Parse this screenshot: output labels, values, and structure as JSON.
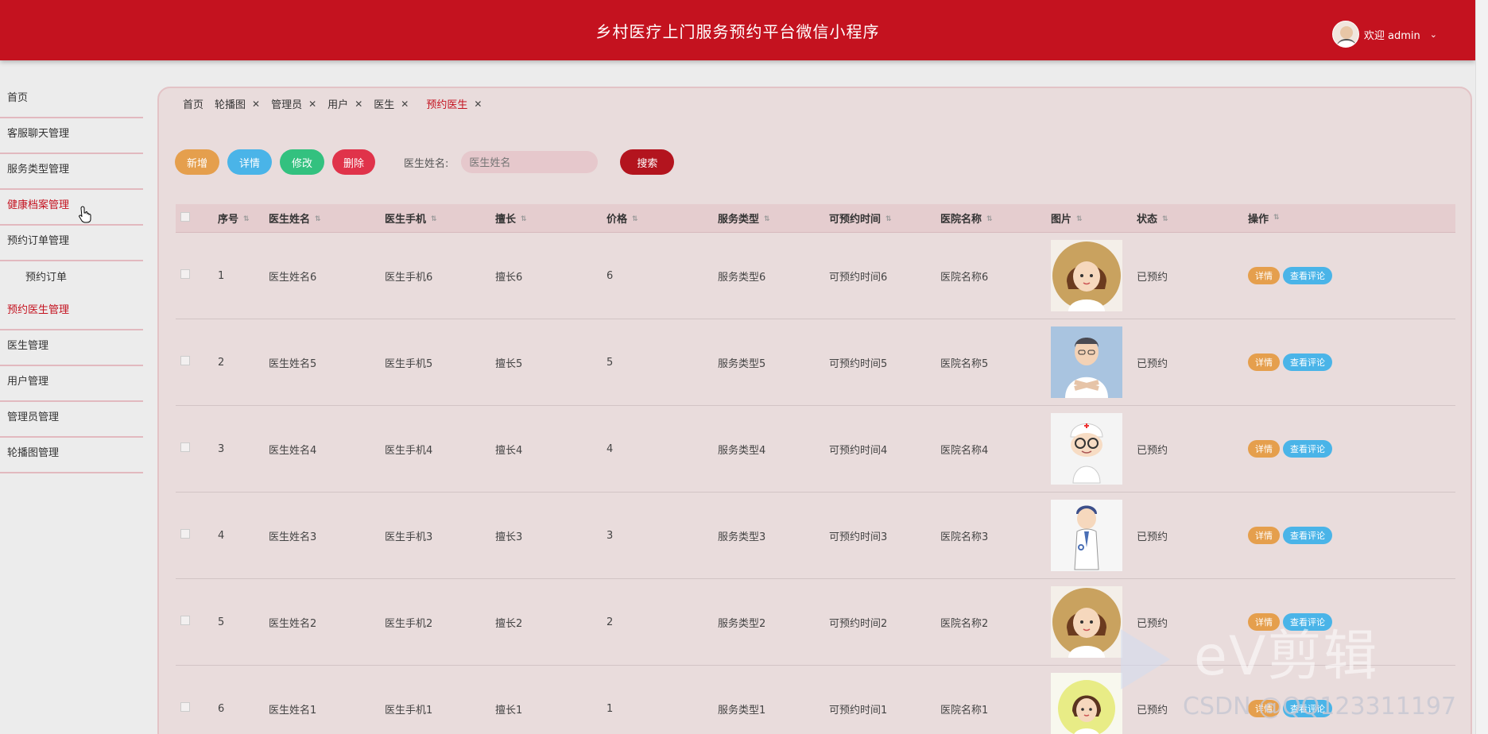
{
  "header": {
    "title": "乡村医疗上门服务预约平台微信小程序",
    "welcome": "欢迎 admin"
  },
  "sidebar": {
    "items": [
      {
        "label": "首页"
      },
      {
        "label": "客服聊天管理"
      },
      {
        "label": "服务类型管理"
      },
      {
        "label": "健康档案管理"
      },
      {
        "label": "预约订单管理"
      }
    ],
    "sub_item": "预约订单",
    "items_after": [
      {
        "label": "预约医生管理"
      },
      {
        "label": "医生管理"
      },
      {
        "label": "用户管理"
      },
      {
        "label": "管理员管理"
      },
      {
        "label": "轮播图管理"
      }
    ]
  },
  "tabs": [
    {
      "label": "首页"
    },
    {
      "label": "轮播图"
    },
    {
      "label": "管理员"
    },
    {
      "label": "用户"
    },
    {
      "label": "医生"
    },
    {
      "label": "预约医生"
    }
  ],
  "toolbar": {
    "add": "新增",
    "detail": "详情",
    "edit": "修改",
    "delete": "删除",
    "search_label": "医生姓名:",
    "search_placeholder": "医生姓名",
    "search": "搜索"
  },
  "table": {
    "headers": [
      "序号",
      "医生姓名",
      "医生手机",
      "擅长",
      "价格",
      "服务类型",
      "可预约时间",
      "医院名称",
      "图片",
      "状态",
      "操作"
    ],
    "rows": [
      {
        "no": "1",
        "name": "医生姓名6",
        "phone": "医生手机6",
        "spec": "擅长6",
        "price": "6",
        "type": "服务类型6",
        "time": "可预约时间6",
        "hosp": "医院名称6",
        "status": "已预约"
      },
      {
        "no": "2",
        "name": "医生姓名5",
        "phone": "医生手机5",
        "spec": "擅长5",
        "price": "5",
        "type": "服务类型5",
        "time": "可预约时间5",
        "hosp": "医院名称5",
        "status": "已预约"
      },
      {
        "no": "3",
        "name": "医生姓名4",
        "phone": "医生手机4",
        "spec": "擅长4",
        "price": "4",
        "type": "服务类型4",
        "time": "可预约时间4",
        "hosp": "医院名称4",
        "status": "已预约"
      },
      {
        "no": "4",
        "name": "医生姓名3",
        "phone": "医生手机3",
        "spec": "擅长3",
        "price": "3",
        "type": "服务类型3",
        "time": "可预约时间3",
        "hosp": "医院名称3",
        "status": "已预约"
      },
      {
        "no": "5",
        "name": "医生姓名2",
        "phone": "医生手机2",
        "spec": "擅长2",
        "price": "2",
        "type": "服务类型2",
        "time": "可预约时间2",
        "hosp": "医院名称2",
        "status": "已预约"
      },
      {
        "no": "6",
        "name": "医生姓名1",
        "phone": "医生手机1",
        "spec": "擅长1",
        "price": "1",
        "type": "服务类型1",
        "time": "可预约时间1",
        "hosp": "医院名称1",
        "status": "已预约"
      }
    ],
    "op_detail": "详情",
    "op_review": "查看评论"
  },
  "watermarks": {
    "ev": "eV剪辑",
    "csdn": "CSDN @QQ123311197"
  },
  "colors": {
    "header": "#c4121f",
    "active": "#c4121f",
    "add": "#e59f4d",
    "detail": "#4ab4e8",
    "edit": "#33c17f",
    "delete": "#e0334a",
    "search": "#b3141e"
  }
}
